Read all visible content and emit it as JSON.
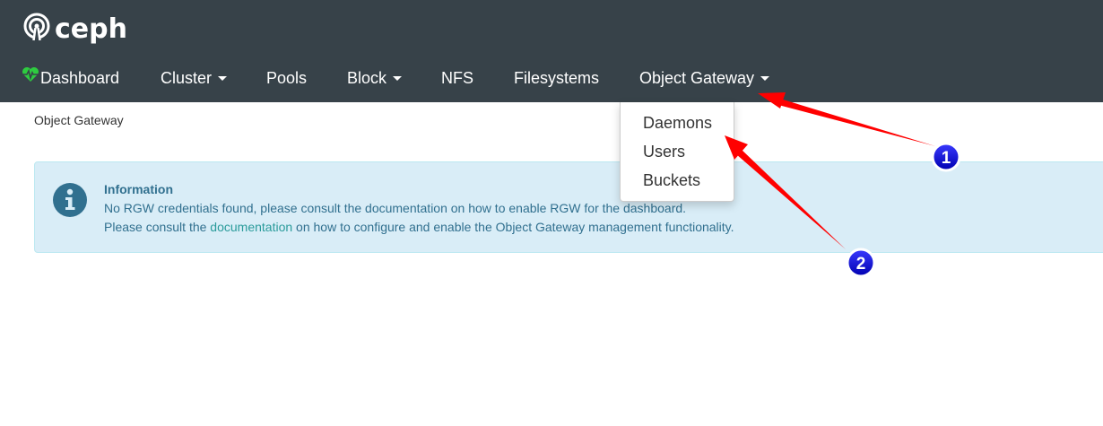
{
  "brand": {
    "name": "ceph",
    "logo_icon": "ceph-logo-icon"
  },
  "nav": {
    "items": [
      {
        "label": "Dashboard",
        "icon": "heartbeat-icon",
        "dropdown": false
      },
      {
        "label": "Cluster",
        "dropdown": true
      },
      {
        "label": "Pools",
        "dropdown": false
      },
      {
        "label": "Block",
        "dropdown": true
      },
      {
        "label": "NFS",
        "dropdown": false
      },
      {
        "label": "Filesystems",
        "dropdown": false
      },
      {
        "label": "Object Gateway",
        "dropdown": true
      }
    ]
  },
  "breadcrumb": "Object Gateway",
  "dropdown_menu": {
    "items": [
      "Daemons",
      "Users",
      "Buckets"
    ]
  },
  "alert": {
    "icon": "info-circle-icon",
    "title": "Information",
    "line1": "No RGW credentials found, please consult the documentation on how to enable RGW for the dashboard.",
    "line2_prefix": "Please consult the ",
    "line2_link": "documentation",
    "line2_suffix": " on how to configure and enable the Object Gateway management functionality."
  },
  "annotations": [
    {
      "label": "1"
    },
    {
      "label": "2"
    }
  ],
  "colors": {
    "navbar_bg": "#374249",
    "heartbeat_green": "#2ecc40",
    "alert_bg": "#d9edf7",
    "alert_text": "#31708f",
    "link": "#2a9b9b",
    "arrow_red": "#ff0000",
    "badge_blue": "#0a0ad0"
  }
}
